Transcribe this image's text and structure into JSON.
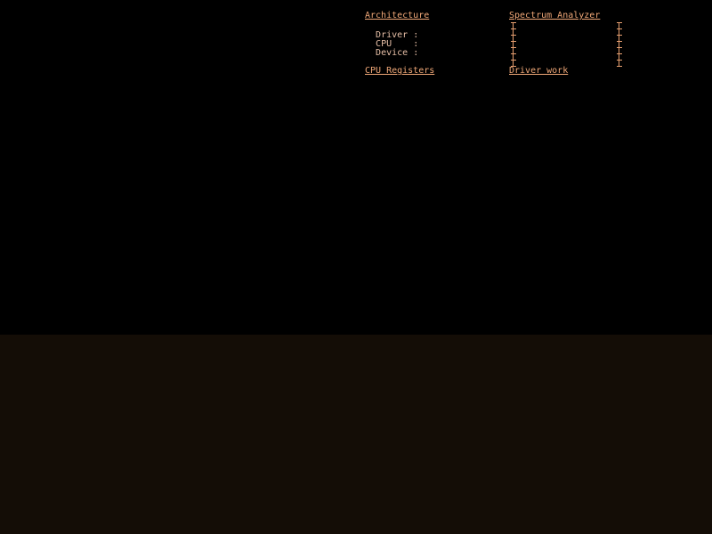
{
  "architecture": {
    "title": "Architecture",
    "fields": [
      {
        "label": "Driver",
        "sep": ":",
        "value": ""
      },
      {
        "label": "CPU",
        "sep": ":",
        "value": ""
      },
      {
        "label": "Device",
        "sep": ":",
        "value": ""
      }
    ]
  },
  "spectrum_analyzer": {
    "title": "Spectrum Analyzer"
  },
  "cpu_registers": {
    "title": "CPU Registers"
  },
  "driver_work": {
    "title": "Driver work"
  },
  "colors": {
    "background_top": "#000000",
    "background_bottom": "#140d06",
    "text_accent": "#f0a878",
    "text_body": "#e8c0a8"
  }
}
